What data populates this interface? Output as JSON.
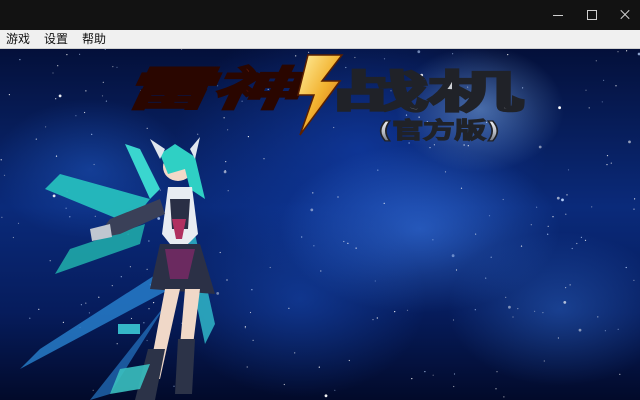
{
  "window": {
    "controls": {
      "minimize_icon": "minimize-icon",
      "maximize_icon": "maximize-icon",
      "close_icon": "close-icon"
    }
  },
  "menu": {
    "items": [
      "游戏",
      "设置",
      "帮助"
    ]
  },
  "game": {
    "logo": {
      "title_part1": "雷神",
      "title_part2": "战机",
      "edition": "(官方版)"
    },
    "colors": {
      "space_dark": "#04103a",
      "nebula_blue": "#2a6cf0",
      "logo_red": "#c0201a",
      "logo_gold": "#f2b230",
      "logo_silver": "#d8d8d8",
      "character_teal": "#27c4c0"
    }
  }
}
